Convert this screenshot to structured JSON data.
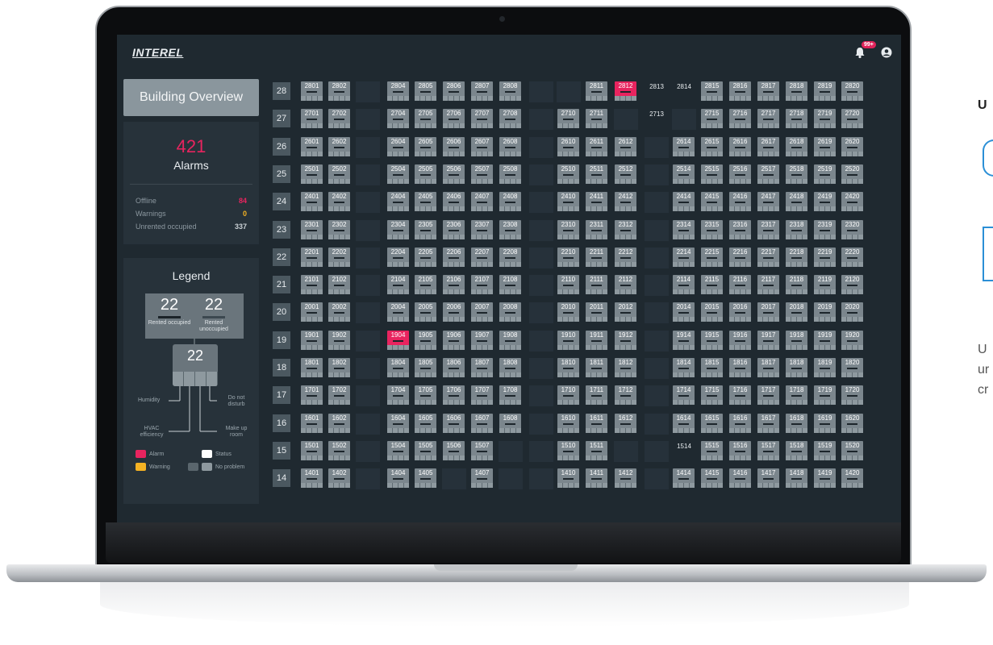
{
  "app": {
    "logo": "INTEREL",
    "notification_badge": "99+"
  },
  "sidebar": {
    "overview_button": "Building Overview",
    "alarms": {
      "count": "421",
      "label": "Alarms",
      "stats": [
        {
          "label": "Offline",
          "value": "84",
          "color": "#e8245f"
        },
        {
          "label": "Warnings",
          "value": "0",
          "color": "#f4b223"
        },
        {
          "label": "Unrented occupied",
          "value": "337",
          "color": "#c9d0d4"
        }
      ]
    },
    "legend": {
      "title": "Legend",
      "left_num": "22",
      "right_num": "22",
      "left_caption": "Rented occupied",
      "right_caption": "Rented unoccupied",
      "tile_num": "22",
      "humidity": "Humidity",
      "dnd": "Do not disturb",
      "hvac": "HVAC efficiency",
      "makeup": "Make up room",
      "alarm": "Alarm",
      "status": "Status",
      "warning": "Warning",
      "no_problem": "No problem"
    }
  },
  "floors": [
    {
      "floor": "28",
      "rooms": [
        "2801",
        "2802",
        "",
        "2804",
        "2805",
        "2806",
        "2807",
        "2808",
        "",
        "",
        "2811",
        "2812",
        "~2813",
        "~2814",
        "2815",
        "2816",
        "2817",
        "2818",
        "2819",
        "2820"
      ]
    },
    {
      "floor": "27",
      "rooms": [
        "2701",
        "2702",
        "",
        "2704",
        "2705",
        "2706",
        "2707",
        "2708",
        "",
        "2710",
        "2711",
        "",
        "~2713",
        "",
        "2715",
        "2716",
        "2717",
        "2718",
        "2719",
        "2720"
      ]
    },
    {
      "floor": "26",
      "rooms": [
        "2601",
        "2602",
        "",
        "2604",
        "2605",
        "2606",
        "2607",
        "2608",
        "",
        "2610",
        "2611",
        "2612",
        "",
        "2614",
        "2615",
        "2616",
        "2617",
        "2618",
        "2619",
        "2620"
      ]
    },
    {
      "floor": "25",
      "rooms": [
        "2501",
        "2502",
        "",
        "2504",
        "2505",
        "2506",
        "2507",
        "2508",
        "",
        "2510",
        "2511",
        "2512",
        "",
        "2514",
        "2515",
        "2516",
        "2517",
        "2518",
        "2519",
        "2520"
      ]
    },
    {
      "floor": "24",
      "rooms": [
        "2401",
        "2402",
        "",
        "2404",
        "2405",
        "2406",
        "2407",
        "2408",
        "",
        "2410",
        "2411",
        "2412",
        "",
        "2414",
        "2415",
        "2416",
        "2417",
        "2418",
        "2419",
        "2420"
      ]
    },
    {
      "floor": "23",
      "rooms": [
        "2301",
        "2302",
        "",
        "2304",
        "2305",
        "2306",
        "2307",
        "2308",
        "",
        "2310",
        "2311",
        "2312",
        "",
        "2314",
        "2315",
        "2316",
        "2317",
        "2318",
        "2319",
        "2320"
      ]
    },
    {
      "floor": "22",
      "rooms": [
        "2201",
        "2202",
        "",
        "2204",
        "2205",
        "2206",
        "2207",
        "2208",
        "",
        "2210",
        "2211",
        "2212",
        "",
        "2214",
        "2215",
        "2216",
        "2217",
        "2218",
        "2219",
        "2220"
      ]
    },
    {
      "floor": "21",
      "rooms": [
        "2101",
        "2102",
        "",
        "2104",
        "2105",
        "2106",
        "2107",
        "2108",
        "",
        "2110",
        "2111",
        "2112",
        "",
        "2114",
        "2115",
        "2116",
        "2117",
        "2118",
        "2119",
        "2120"
      ]
    },
    {
      "floor": "20",
      "rooms": [
        "2001",
        "2002",
        "",
        "2004",
        "2005",
        "2006",
        "2007",
        "2008",
        "",
        "2010",
        "2011",
        "2012",
        "",
        "2014",
        "2015",
        "2016",
        "2017",
        "2018",
        "2019",
        "2020"
      ]
    },
    {
      "floor": "19",
      "rooms": [
        "1901",
        "1902",
        "",
        "1904",
        "1905",
        "1906",
        "1907",
        "1908",
        "",
        "1910",
        "1911",
        "1912",
        "",
        "1914",
        "1915",
        "1916",
        "1917",
        "1918",
        "1919",
        "1920"
      ]
    },
    {
      "floor": "18",
      "rooms": [
        "1801",
        "1802",
        "",
        "1804",
        "1805",
        "1806",
        "1807",
        "1808",
        "",
        "1810",
        "1811",
        "1812",
        "",
        "1814",
        "1815",
        "1816",
        "1817",
        "1818",
        "1819",
        "1820"
      ]
    },
    {
      "floor": "17",
      "rooms": [
        "1701",
        "1702",
        "",
        "1704",
        "1705",
        "1706",
        "1707",
        "1708",
        "",
        "1710",
        "1711",
        "1712",
        "",
        "1714",
        "1715",
        "1716",
        "1717",
        "1718",
        "1719",
        "1720"
      ]
    },
    {
      "floor": "16",
      "rooms": [
        "1601",
        "1602",
        "",
        "1604",
        "1605",
        "1606",
        "1607",
        "1608",
        "",
        "1610",
        "1611",
        "1612",
        "",
        "1614",
        "1615",
        "1616",
        "1617",
        "1618",
        "1619",
        "1620"
      ]
    },
    {
      "floor": "15",
      "rooms": [
        "1501",
        "1502",
        "",
        "1504",
        "1505",
        "1506",
        "1507",
        "",
        "",
        "1510",
        "1511",
        "",
        "",
        "~1514",
        "1515",
        "1516",
        "1517",
        "1518",
        "1519",
        "1520"
      ]
    },
    {
      "floor": "14",
      "rooms": [
        "1401",
        "1402",
        "",
        "1404",
        "1405",
        "",
        "1407",
        "",
        "",
        "1410",
        "1411",
        "1412",
        "",
        "1414",
        "1415",
        "1416",
        "1417",
        "1418",
        "1419",
        "1420"
      ]
    }
  ],
  "alarm_rooms": [
    "2812",
    "1904"
  ],
  "colors": {
    "alarm": "#e8245f",
    "warning": "#f4b223",
    "room": "#7b868d",
    "background": "#1f2930"
  },
  "page_text": {
    "heading": "U",
    "line1": "U",
    "line2": "ur",
    "line3": "cr"
  }
}
